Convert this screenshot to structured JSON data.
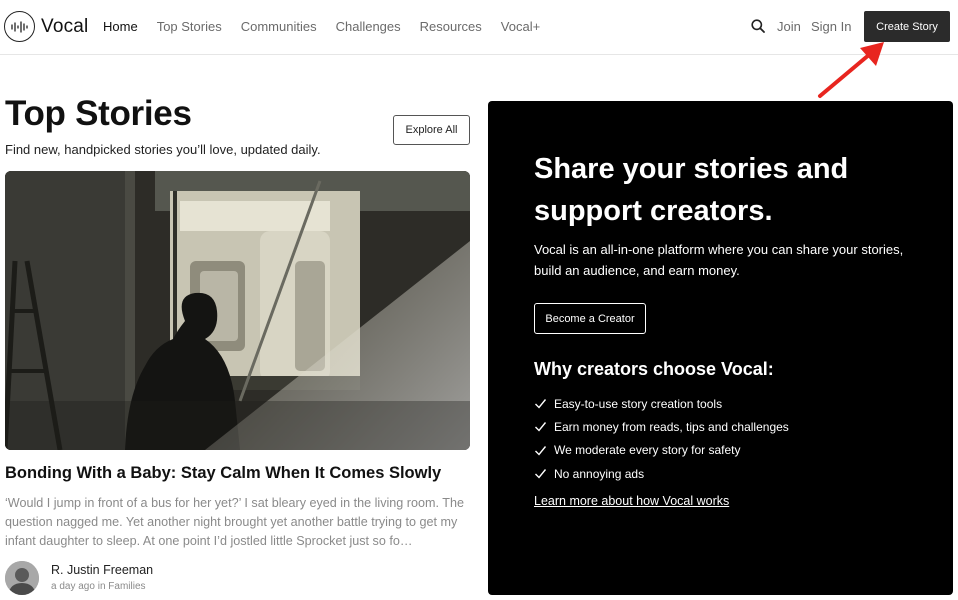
{
  "header": {
    "logo_text": "Vocal",
    "nav": [
      {
        "label": "Home",
        "active": true
      },
      {
        "label": "Top Stories",
        "active": false
      },
      {
        "label": "Communities",
        "active": false
      },
      {
        "label": "Challenges",
        "active": false
      },
      {
        "label": "Resources",
        "active": false
      },
      {
        "label": "Vocal+",
        "active": false
      }
    ],
    "join_label": "Join",
    "signin_label": "Sign In",
    "create_story_label": "Create Story",
    "icons": {
      "search": "search-icon",
      "logo": "vocal-logo-icon"
    }
  },
  "main": {
    "title": "Top Stories",
    "subtitle": "Find new, handpicked stories you’ll love, updated daily.",
    "explore_all_label": "Explore All",
    "featured_story": {
      "title": "Bonding With a Baby: Stay Calm When It Comes Slowly",
      "excerpt": "‘Would I jump in front of a bus for her yet?’ I sat bleary eyed in the living room. The question nagged me. Yet another night brought yet another battle trying to get my infant daughter to sleep. At one point I’d jostled little Sprocket just so fo…",
      "author": "R. Justin Freeman",
      "time": "a day ago",
      "in_label": "in",
      "category": "Families"
    }
  },
  "promo": {
    "heading": "Share your stories and support creators.",
    "text": "Vocal is an all-in-one platform where you can share your stories, build an audience, and earn money.",
    "become_creator_label": "Become a Creator",
    "why_heading": "Why creators choose Vocal:",
    "benefits": [
      "Easy-to-use story creation tools",
      "Earn money from reads, tips and challenges",
      "We moderate every story for safety",
      "No annoying ads"
    ],
    "learn_more_label": "Learn more about how Vocal works"
  },
  "colors": {
    "create_button_bg": "#2b2b2b",
    "promo_bg": "#000000",
    "arrow": "#e8251f",
    "nav_text": "#6b6b6b",
    "excerpt_text": "#8a8a8a"
  }
}
